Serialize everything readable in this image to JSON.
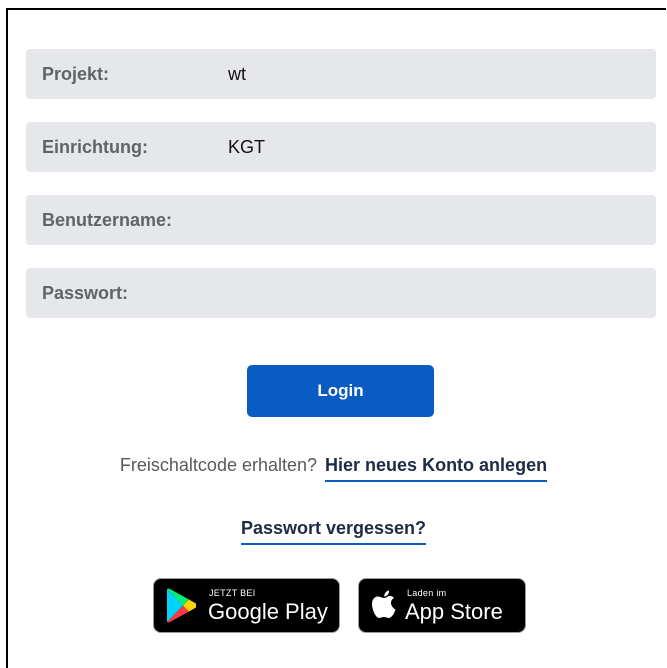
{
  "form": {
    "fields": [
      {
        "label": "Projekt:",
        "value": ""
      },
      {
        "label": "Einrichtung:",
        "value": ""
      },
      {
        "label": "Benutzername:",
        "value": ""
      },
      {
        "label": "Passwort:",
        "value": ""
      }
    ],
    "values": {
      "project": "wt",
      "facility": "KGT"
    }
  },
  "login_button": "Login",
  "signup": {
    "prompt": "Freischaltcode erhalten?",
    "link": "Hier neues Konto anlegen"
  },
  "forgot_password": "Passwort vergessen?",
  "badges": {
    "google_play": {
      "small": "JETZT BEI",
      "big": "Google Play",
      "icon": "google-play-icon"
    },
    "app_store": {
      "small": "Laden im",
      "big": "App Store",
      "icon": "apple-icon"
    }
  },
  "colors": {
    "field_bg": "#e6e7ea",
    "primary": "#0a5cc2",
    "label": "#5f6469"
  }
}
